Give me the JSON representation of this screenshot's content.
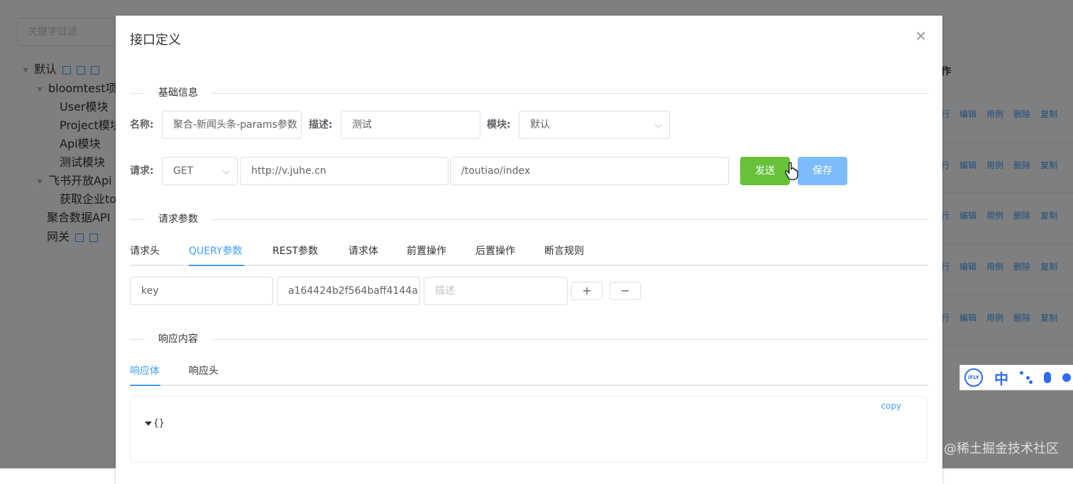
{
  "background": {
    "filter_placeholder": "关键字过滤",
    "tree": [
      {
        "label": "默认",
        "level": 0
      },
      {
        "label": "bloomtest项目",
        "level": 1
      },
      {
        "label": "User模块",
        "level": 2
      },
      {
        "label": "Project模块",
        "level": 2
      },
      {
        "label": "Api模块",
        "level": 2
      },
      {
        "label": "测试模块",
        "level": 2
      },
      {
        "label": "飞书开放Api",
        "level": 1
      },
      {
        "label": "获取企业to",
        "level": 2
      },
      {
        "label": "聚合数据API",
        "level": 1
      },
      {
        "label": "网关",
        "level": 1
      }
    ],
    "right_header": "作",
    "row_ops": [
      "行",
      "编辑",
      "用例",
      "删除",
      "复制"
    ]
  },
  "dialog": {
    "title": "接口定义",
    "close": "×",
    "basic_section": "基础信息",
    "name_label": "名称:",
    "name_value": "聚合-新闻头条-params参数",
    "desc_label": "描述:",
    "desc_value": "测试",
    "module_label": "模块:",
    "module_value": "默认",
    "request_label": "请求:",
    "method_value": "GET",
    "host_value": "http://v.juhe.cn",
    "path_value": "/toutiao/index",
    "send_button": "发送",
    "save_button": "保存",
    "params_section": "请求参数",
    "param_tabs": [
      "请求头",
      "QUERY参数",
      "REST参数",
      "请求体",
      "前置操作",
      "后置操作",
      "断言规则"
    ],
    "active_param_tab": "QUERY参数",
    "param_row": {
      "key": "key",
      "value": "a164424b2f564baff4144a",
      "desc_placeholder": "描述",
      "add": "+",
      "remove": "−"
    },
    "response_section": "响应内容",
    "response_tabs": [
      "响应体",
      "响应头"
    ],
    "active_response_tab": "响应体",
    "copy_label": "copy",
    "json_body": "{}"
  },
  "ifly": {
    "logo": "iFLY",
    "lang": "中"
  },
  "watermark": "@稀土掘金技术社区",
  "colors": {
    "primary": "#409eff",
    "success": "#67c23a",
    "save": "#7dbcfb"
  }
}
